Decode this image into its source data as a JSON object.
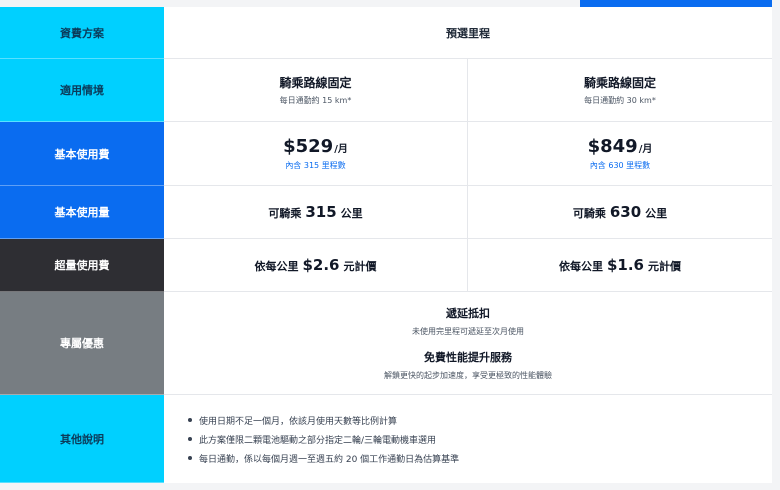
{
  "plan_header": {
    "label": "資費方案",
    "plan_name": "預選里程"
  },
  "scenario": {
    "label": "適用情境",
    "plans": [
      {
        "title": "騎乘路線固定",
        "desc": "每日通勤約 15 km*"
      },
      {
        "title": "騎乘路線固定",
        "desc": "每日通勤約 30 km*"
      }
    ]
  },
  "base_fee": {
    "label": "基本使用費",
    "plans": [
      {
        "price": "$529",
        "unit": "/月",
        "included": "內含 315 里程數"
      },
      {
        "price": "$849",
        "unit": "/月",
        "included": "內含 630 里程數"
      }
    ]
  },
  "base_usage": {
    "label": "基本使用量",
    "prefix": "可騎乘",
    "suffix": "公里",
    "plans": [
      {
        "amount": "315"
      },
      {
        "amount": "630"
      }
    ]
  },
  "overage": {
    "label": "超量使用費",
    "prefix": "依每公里",
    "suffix": "元計價",
    "plans": [
      {
        "rate": "$2.6"
      },
      {
        "rate": "$1.6"
      }
    ]
  },
  "benefits": {
    "label": "專屬優惠",
    "items": [
      {
        "title": "遞延抵扣",
        "desc": "未使用完里程可遞延至次月使用"
      },
      {
        "title": "免費性能提升服務",
        "desc": "解鎖更快的起步加速度，享受更極致的性能體驗"
      }
    ]
  },
  "notes": {
    "label": "其他說明",
    "items": [
      "使用日期不足一個月，依該月使用天數等比例計算",
      "此方案僅限二顆電池驅動之部分指定二輪/三輪電動機車選用",
      "每日通勤，係以每個月週一至週五約 20 個工作通勤日為估算基準"
    ]
  },
  "colors": {
    "cyan": "#00d0ff",
    "blue": "#0a6cf0",
    "dark": "#2e2e33",
    "gray": "#777d82"
  }
}
